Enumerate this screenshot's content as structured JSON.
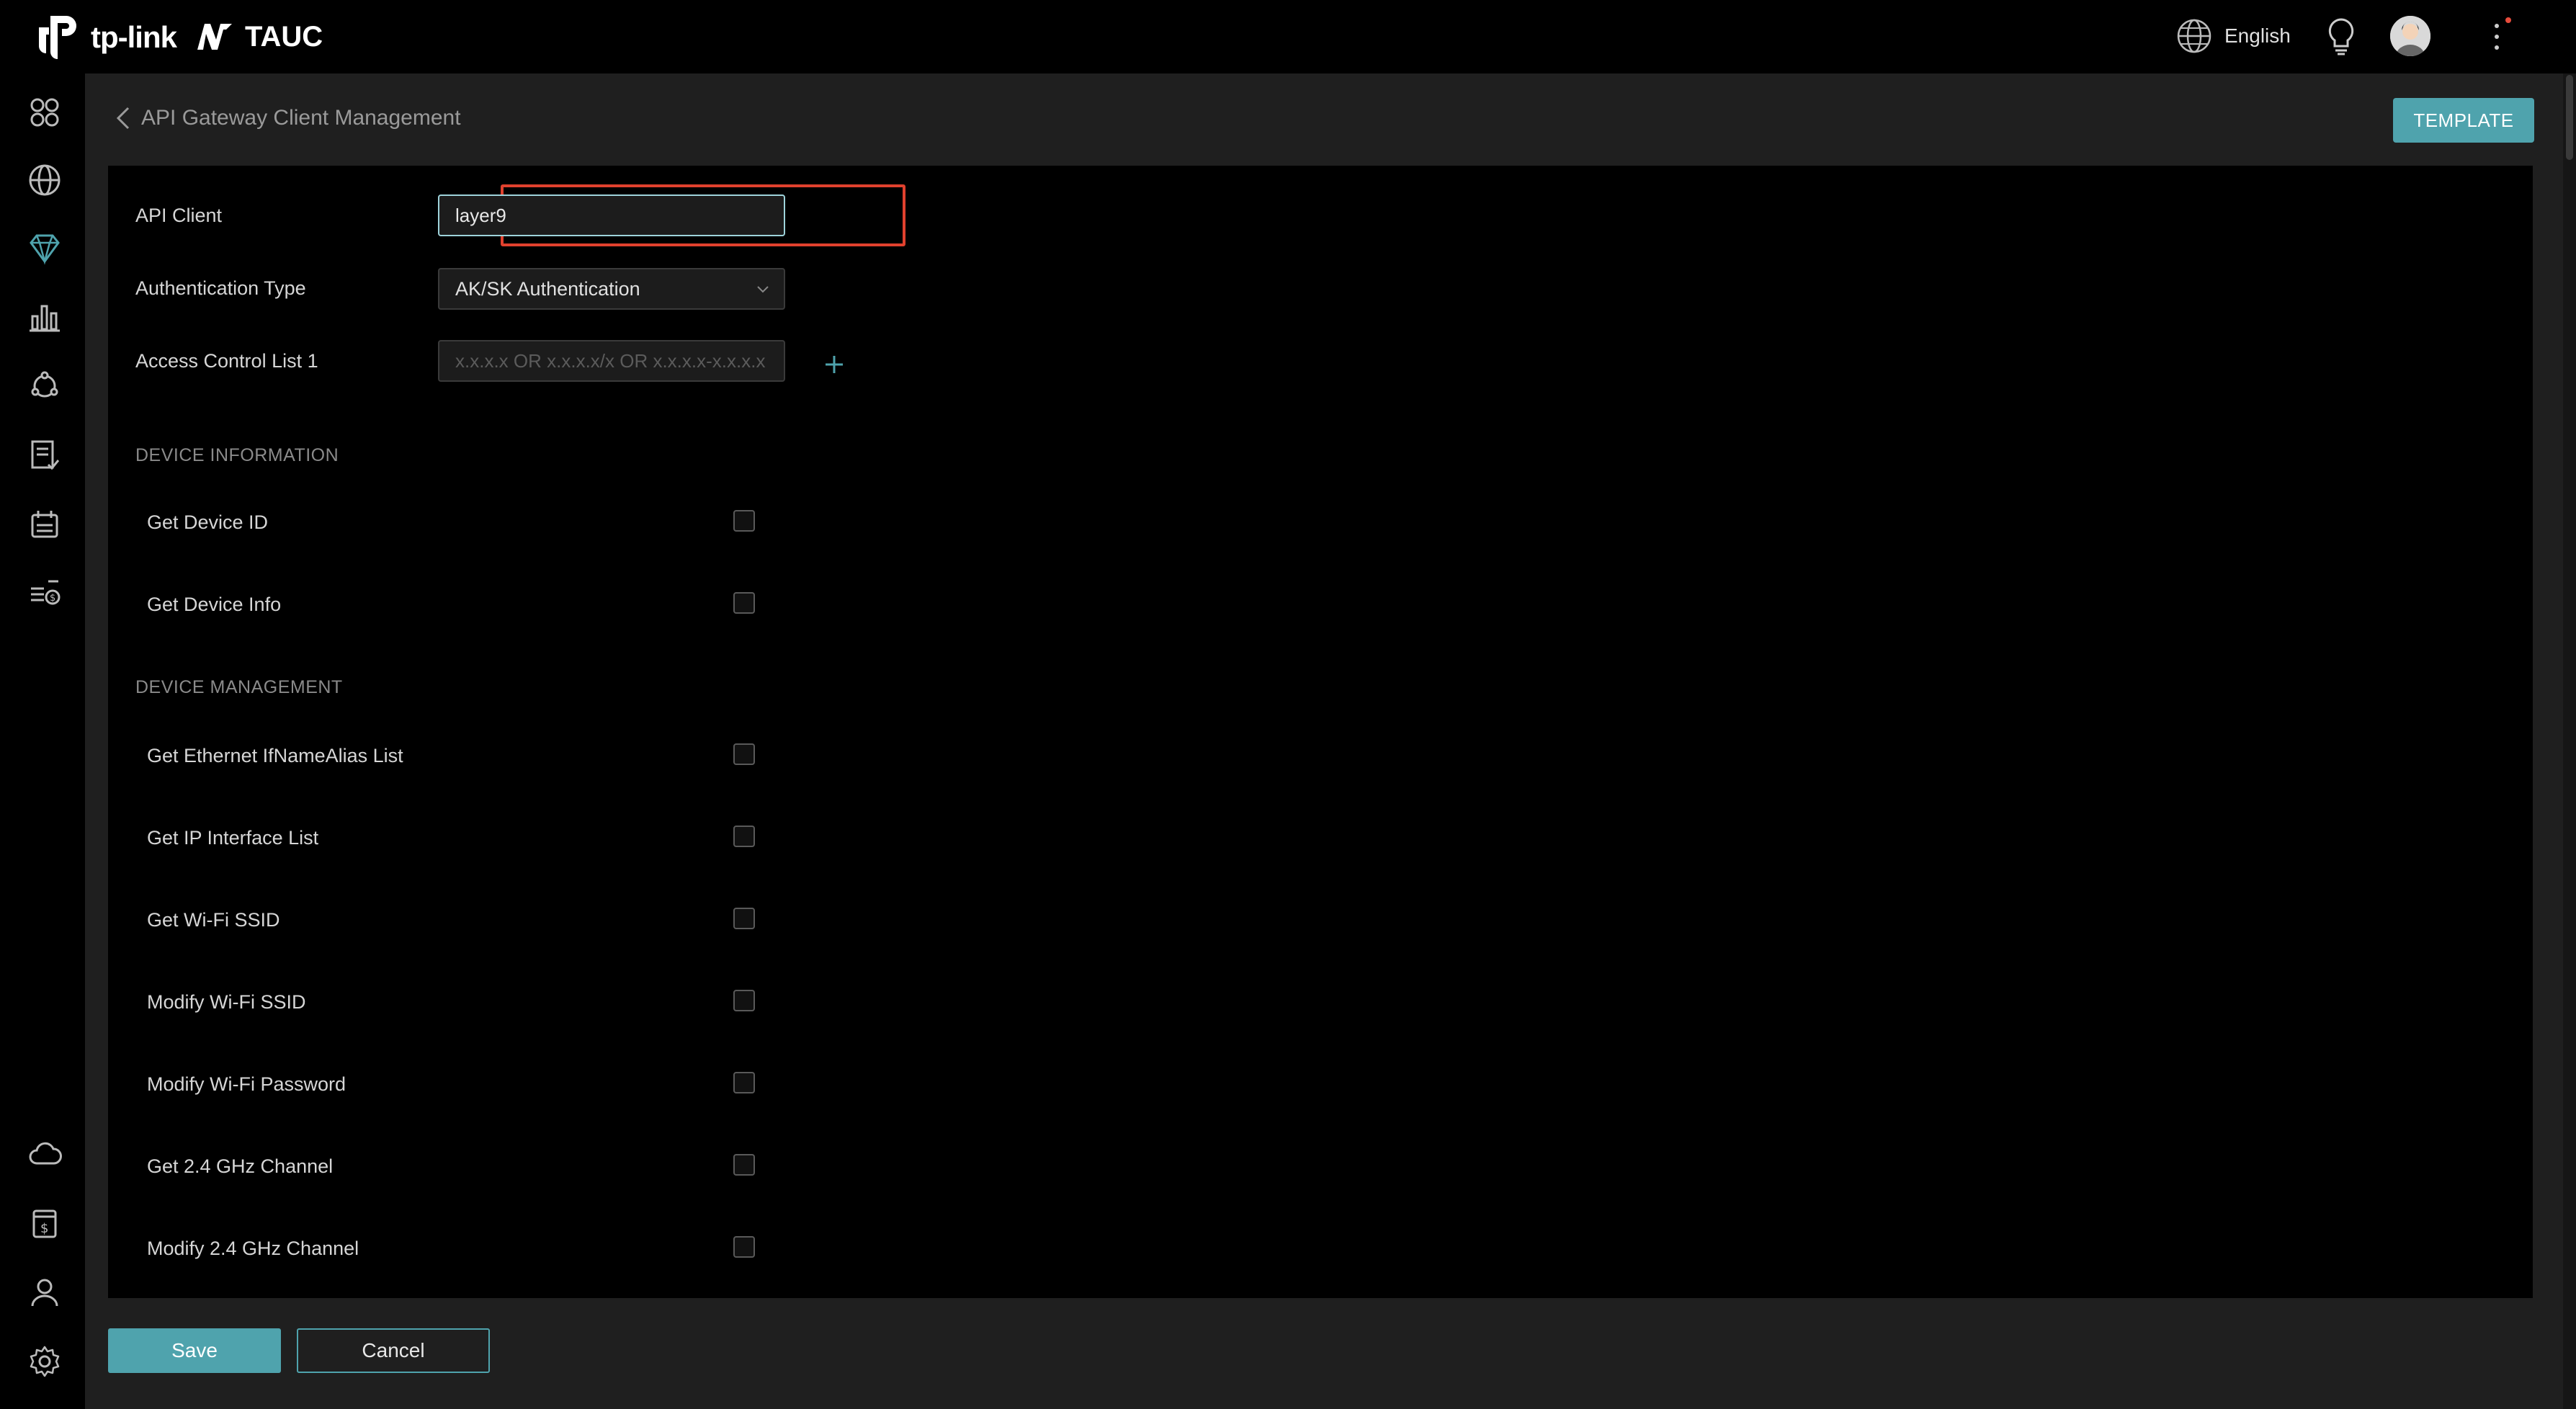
{
  "brand": {
    "logo_text": "tp-link",
    "product": "TAUC"
  },
  "topbar": {
    "language": "English"
  },
  "sidebar": {
    "items": [
      {
        "icon": "dashboard-icon"
      },
      {
        "icon": "globe-icon"
      },
      {
        "icon": "diamond-icon"
      },
      {
        "icon": "analytics-icon"
      },
      {
        "icon": "topology-icon"
      },
      {
        "icon": "checklist-icon"
      },
      {
        "icon": "calendar-icon"
      },
      {
        "icon": "billing-list-icon"
      },
      {
        "icon": "cloud-icon"
      },
      {
        "icon": "payment-icon"
      },
      {
        "icon": "user-icon"
      },
      {
        "icon": "settings-icon"
      }
    ]
  },
  "header": {
    "title": "API Gateway Client Management",
    "template_label": "TEMPLATE"
  },
  "form": {
    "api_client_label": "API Client",
    "api_client_value": "layer9",
    "auth_type_label": "Authentication Type",
    "auth_type_value": "AK/SK Authentication",
    "acl_label": "Access Control List 1",
    "acl_placeholder": "x.x.x.x OR x.x.x.x/x OR x.x.x.x-x.x.x.x"
  },
  "sections": {
    "device_information": {
      "title": "DEVICE INFORMATION",
      "items": [
        "Get Device ID",
        "Get Device Info"
      ]
    },
    "device_management": {
      "title": "DEVICE MANAGEMENT",
      "items": [
        "Get Ethernet IfNameAlias List",
        "Get IP Interface List",
        "Get Wi-Fi SSID",
        "Modify Wi-Fi SSID",
        "Modify Wi-Fi Password",
        "Get 2.4 GHz Channel",
        "Modify 2.4 GHz Channel"
      ]
    }
  },
  "footer": {
    "save_label": "Save",
    "cancel_label": "Cancel"
  },
  "colors": {
    "accent": "#4fa3ad",
    "highlight": "#e0412e",
    "panel": "#000000",
    "frame": "#1f1f1f"
  }
}
